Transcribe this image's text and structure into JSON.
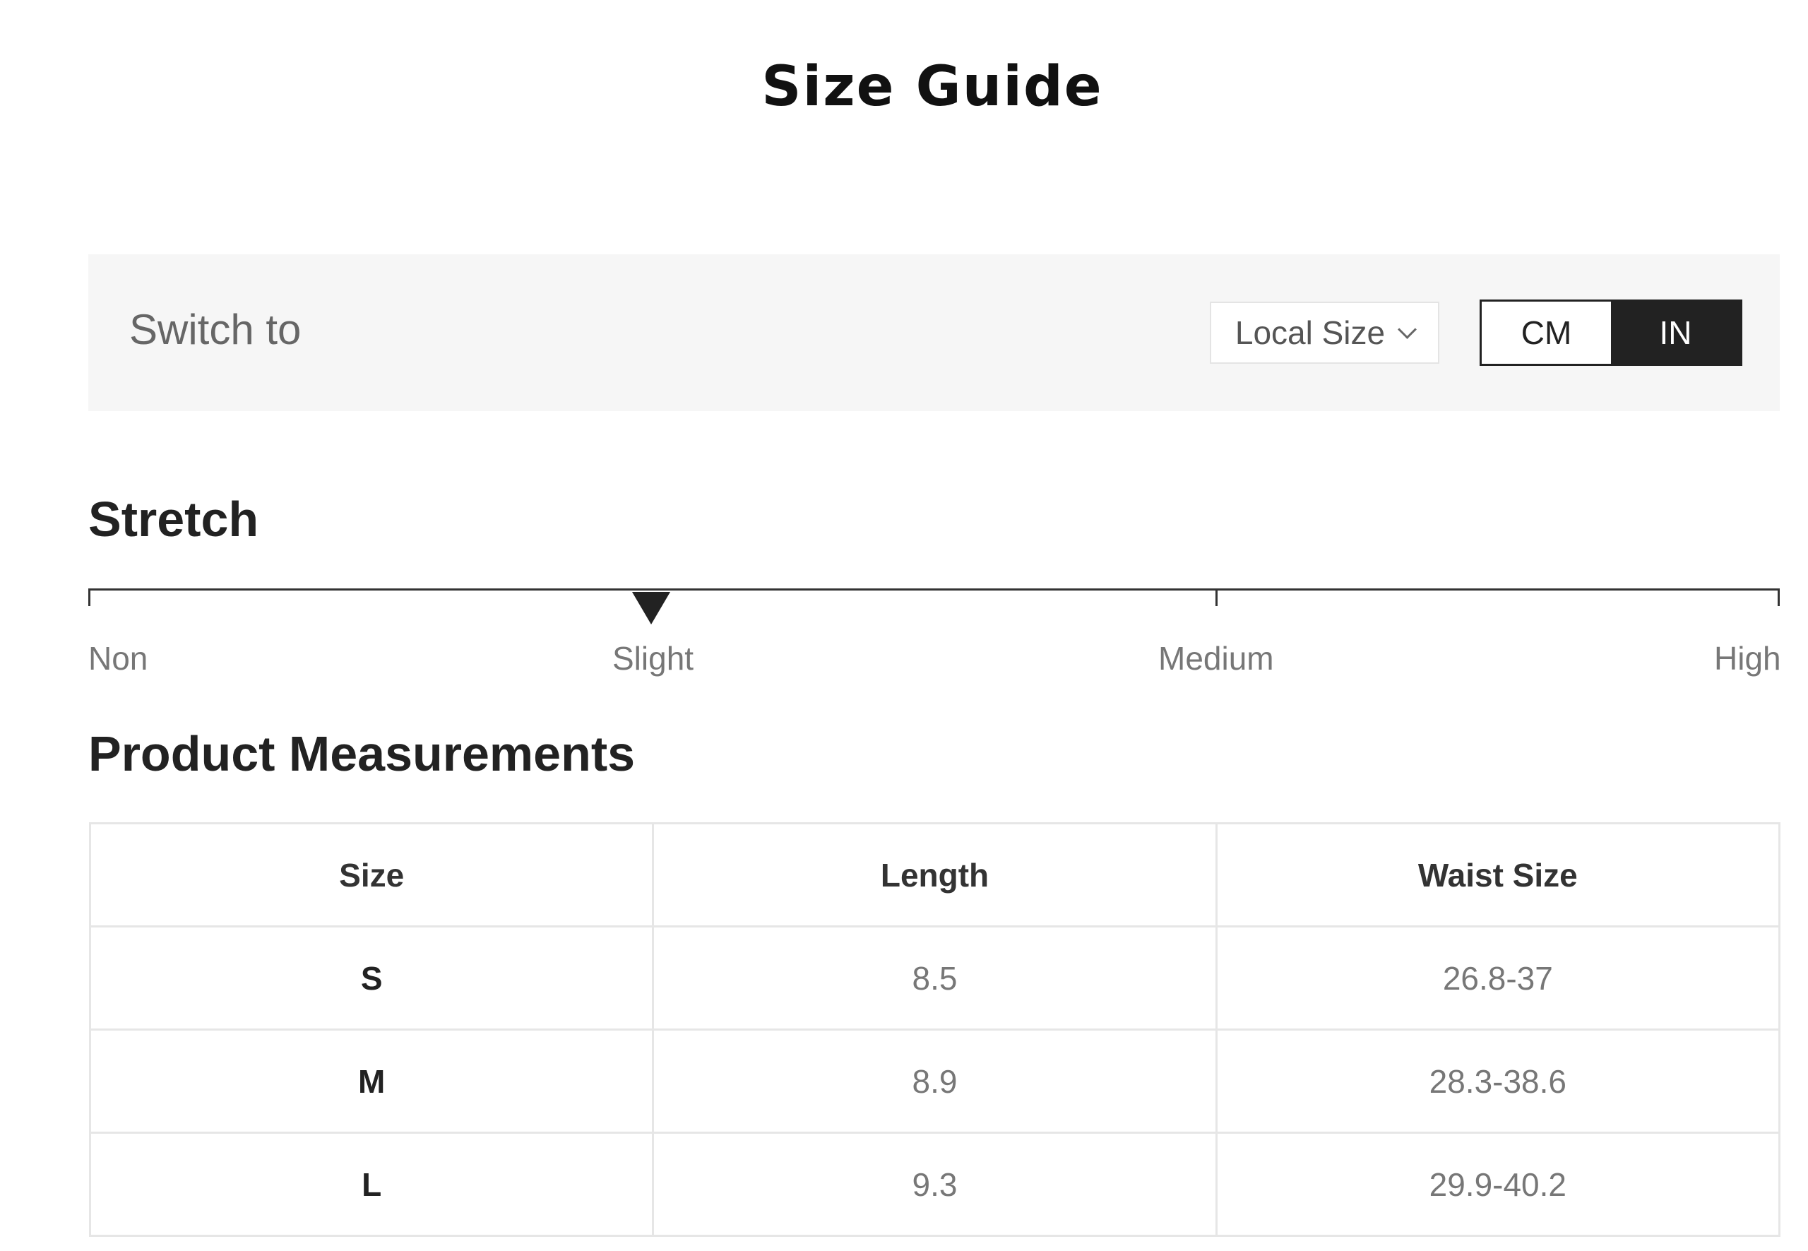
{
  "title": "Size Guide",
  "switch": {
    "label": "Switch to",
    "local_size_label": "Local Size",
    "units": [
      "CM",
      "IN"
    ],
    "selected_unit": "IN"
  },
  "stretch": {
    "title": "Stretch",
    "levels": [
      "Non",
      "Slight",
      "Medium",
      "High"
    ],
    "selected_level": "Slight"
  },
  "measurements": {
    "title": "Product Measurements",
    "columns": [
      "Size",
      "Length",
      "Waist Size"
    ],
    "rows": [
      [
        "S",
        "8.5",
        "26.8-37"
      ],
      [
        "M",
        "8.9",
        "28.3-38.6"
      ],
      [
        "L",
        "9.3",
        "29.9-40.2"
      ]
    ]
  },
  "colors": {
    "bar_background": "#f6f6f6",
    "active_unit": "#222222",
    "table_border": "#e6e6e6"
  },
  "icons": {
    "local_size_dropdown": "chevron-down-icon",
    "stretch_marker": "triangle-down-icon"
  }
}
